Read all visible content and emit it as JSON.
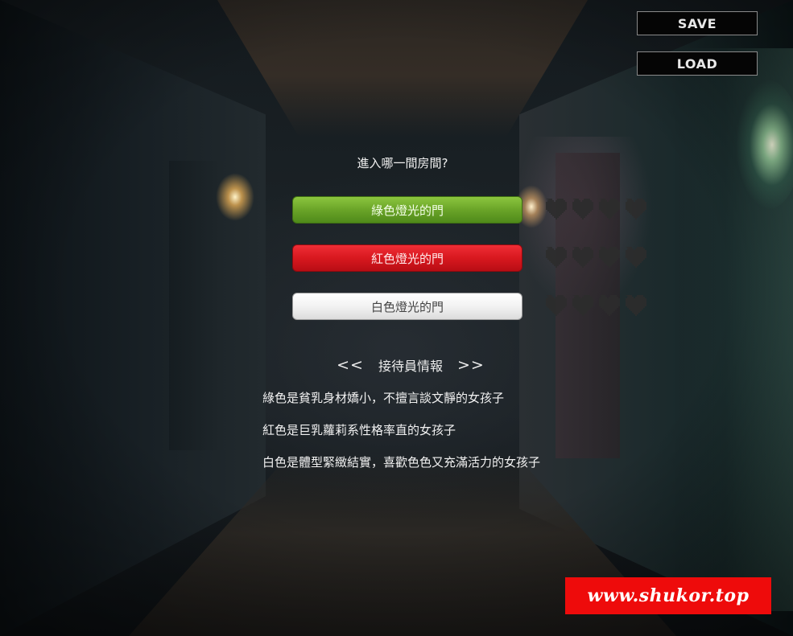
{
  "system": {
    "save_label": "SAVE",
    "load_label": "LOAD"
  },
  "question": "進入哪一間房間?",
  "choices": [
    {
      "label": "綠色燈光的門",
      "color": "#6aa428",
      "hearts_filled": 0,
      "hearts_total": 4
    },
    {
      "label": "紅色燈光的門",
      "color": "#d8181f",
      "hearts_filled": 0,
      "hearts_total": 4
    },
    {
      "label": "白色燈光的門",
      "color": "#f2f2f2",
      "hearts_filled": 0,
      "hearts_total": 4
    }
  ],
  "info": {
    "arrow_left": "<<",
    "title": "接待員情報",
    "arrow_right": ">>",
    "lines": [
      "綠色是貧乳身材嬌小，不擅言談文靜的女孩子",
      "紅色是巨乳蘿莉系性格率直的女孩子",
      "白色是體型緊緻結實，喜歡色色又充滿活力的女孩子"
    ]
  },
  "watermark": "www.shukor.top",
  "colors": {
    "heart_empty": "#2c2c2c",
    "button_bg": "#050505",
    "watermark_bg": "#ee0b0b"
  }
}
